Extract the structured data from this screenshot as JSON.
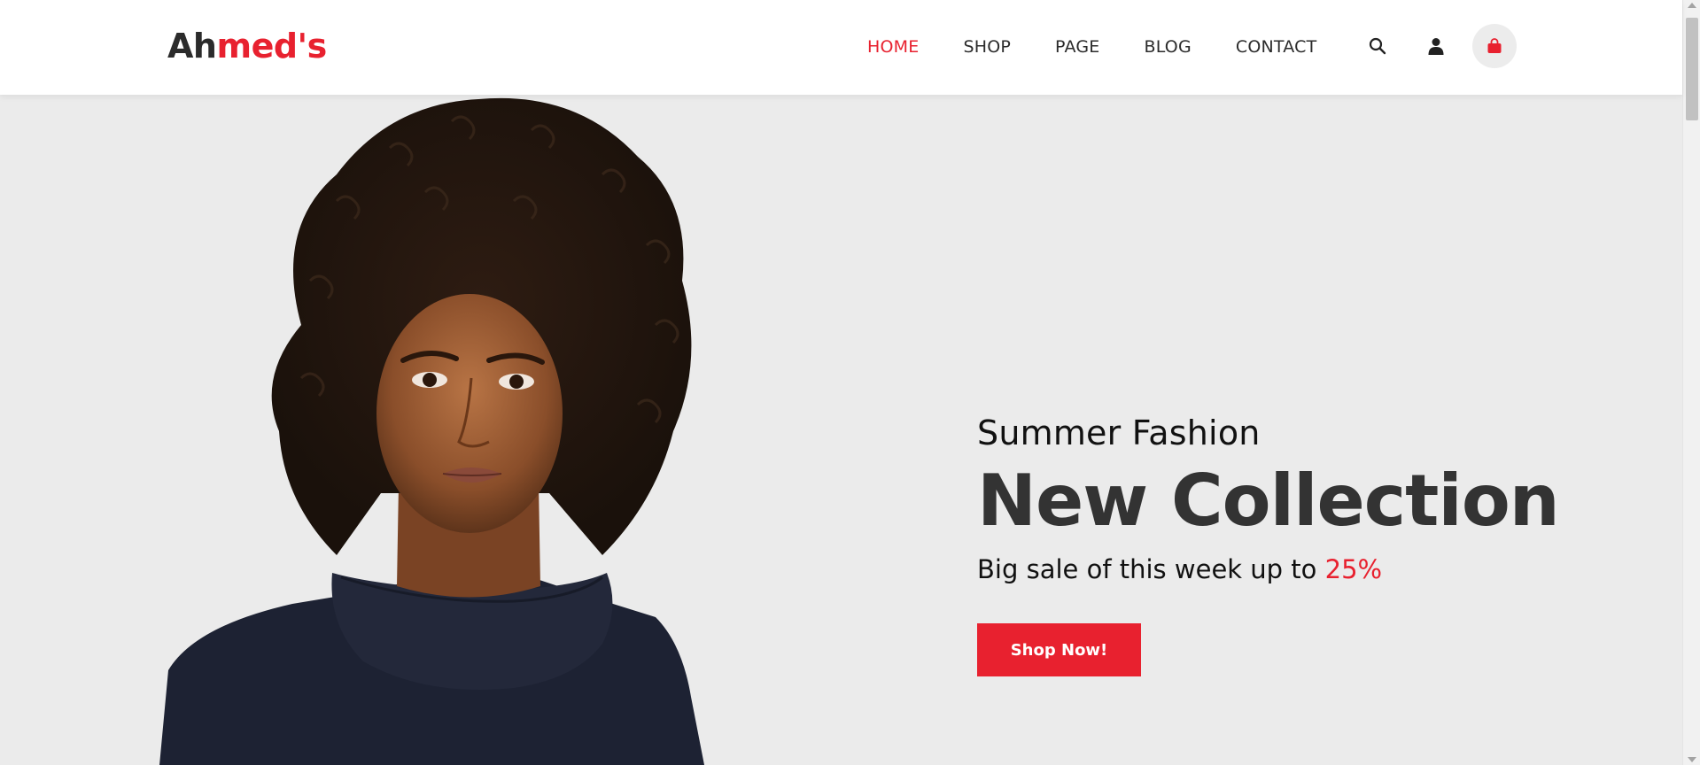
{
  "header": {
    "logo_part1": "Ah",
    "logo_part2": "med's",
    "nav": [
      {
        "label": "HOME",
        "active": true
      },
      {
        "label": "SHOP",
        "active": false
      },
      {
        "label": "PAGE",
        "active": false
      },
      {
        "label": "BLOG",
        "active": false
      },
      {
        "label": "CONTACT",
        "active": false
      }
    ],
    "icons": [
      "search-icon",
      "user-icon",
      "shopping-bag-icon"
    ]
  },
  "hero": {
    "subtitle": "Summer Fashion",
    "title": "New Collection",
    "sale_text": "Big sale of this week up to ",
    "sale_percent": "25%",
    "button_label": "Shop Now!",
    "image": "model-portrait"
  },
  "colors": {
    "accent": "#e8212f",
    "text_dark": "#333333",
    "hero_bg": "#ebebeb",
    "header_bg": "#ffffff"
  }
}
